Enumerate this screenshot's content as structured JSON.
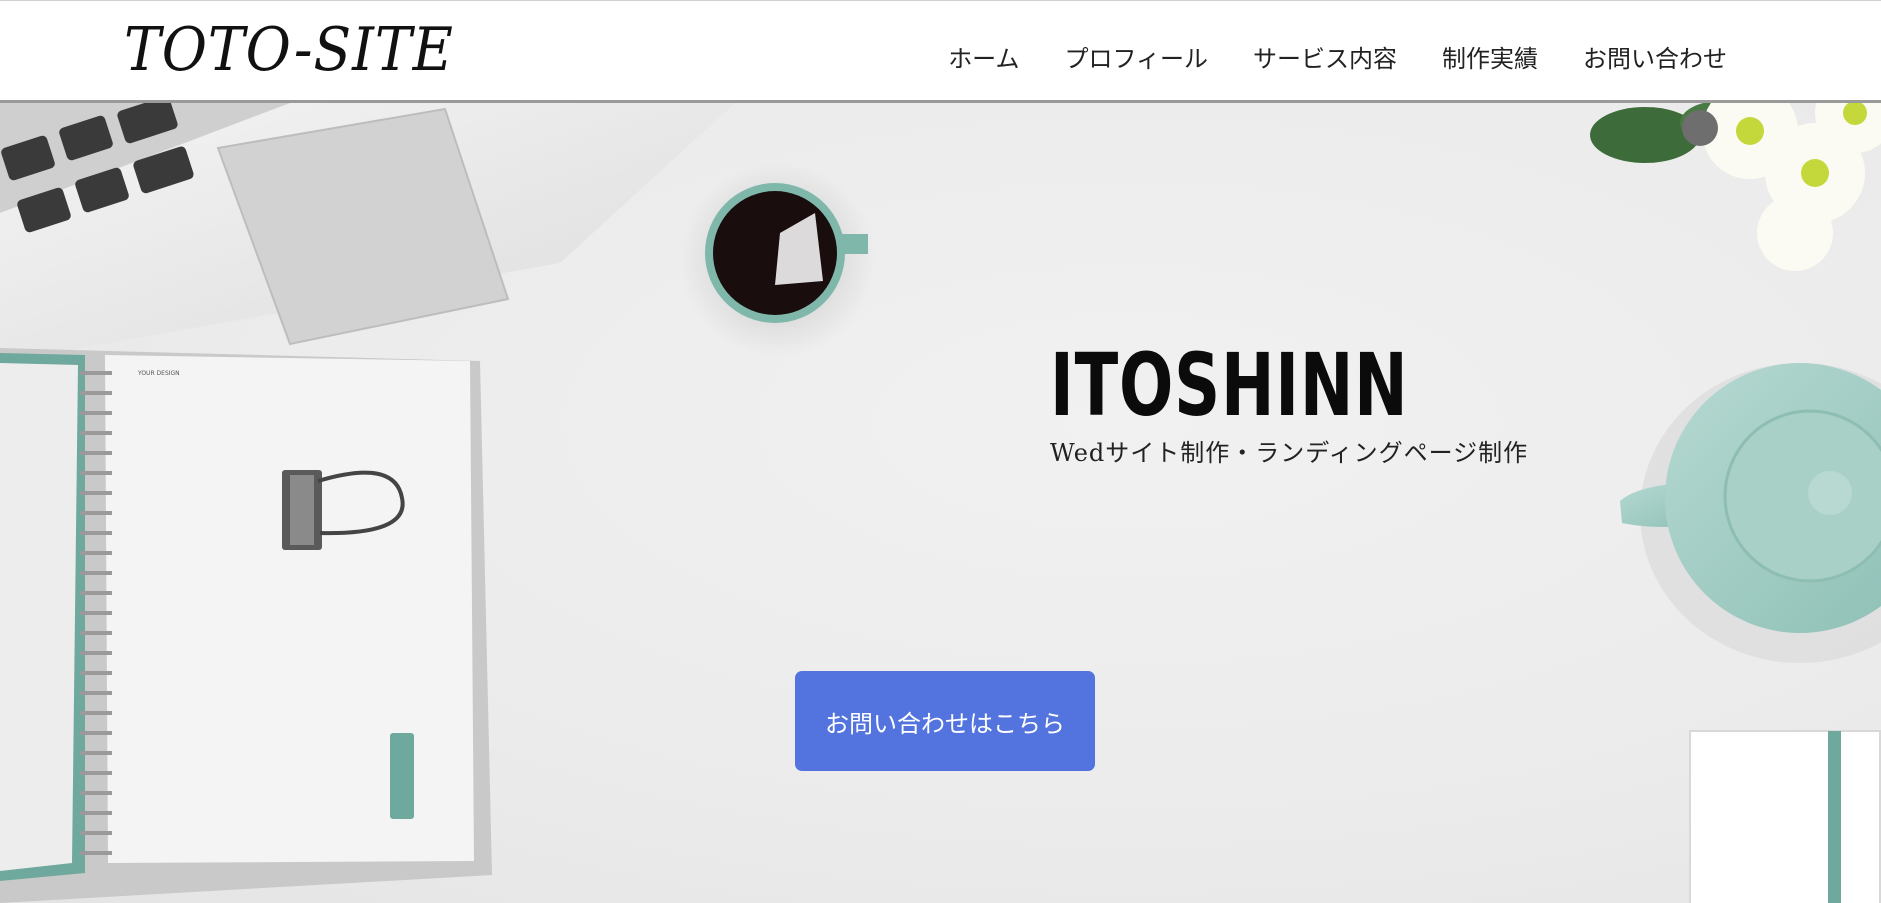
{
  "header": {
    "logo": "TOTO-SITE",
    "nav": [
      {
        "label": "ホーム"
      },
      {
        "label": "プロフィール"
      },
      {
        "label": "サービス内容"
      },
      {
        "label": "制作実績"
      },
      {
        "label": "お問い合わせ"
      }
    ]
  },
  "hero": {
    "title": "ITOSHINN",
    "subtitle": "Wedサイト制作・ランディングページ制作",
    "cta_label": "お問い合わせはこちら",
    "notebook_cover_text": "YOUR DESIGN"
  },
  "colors": {
    "accent": "#5373df",
    "mint": "#7fb7ab",
    "background": "#ebebeb"
  }
}
